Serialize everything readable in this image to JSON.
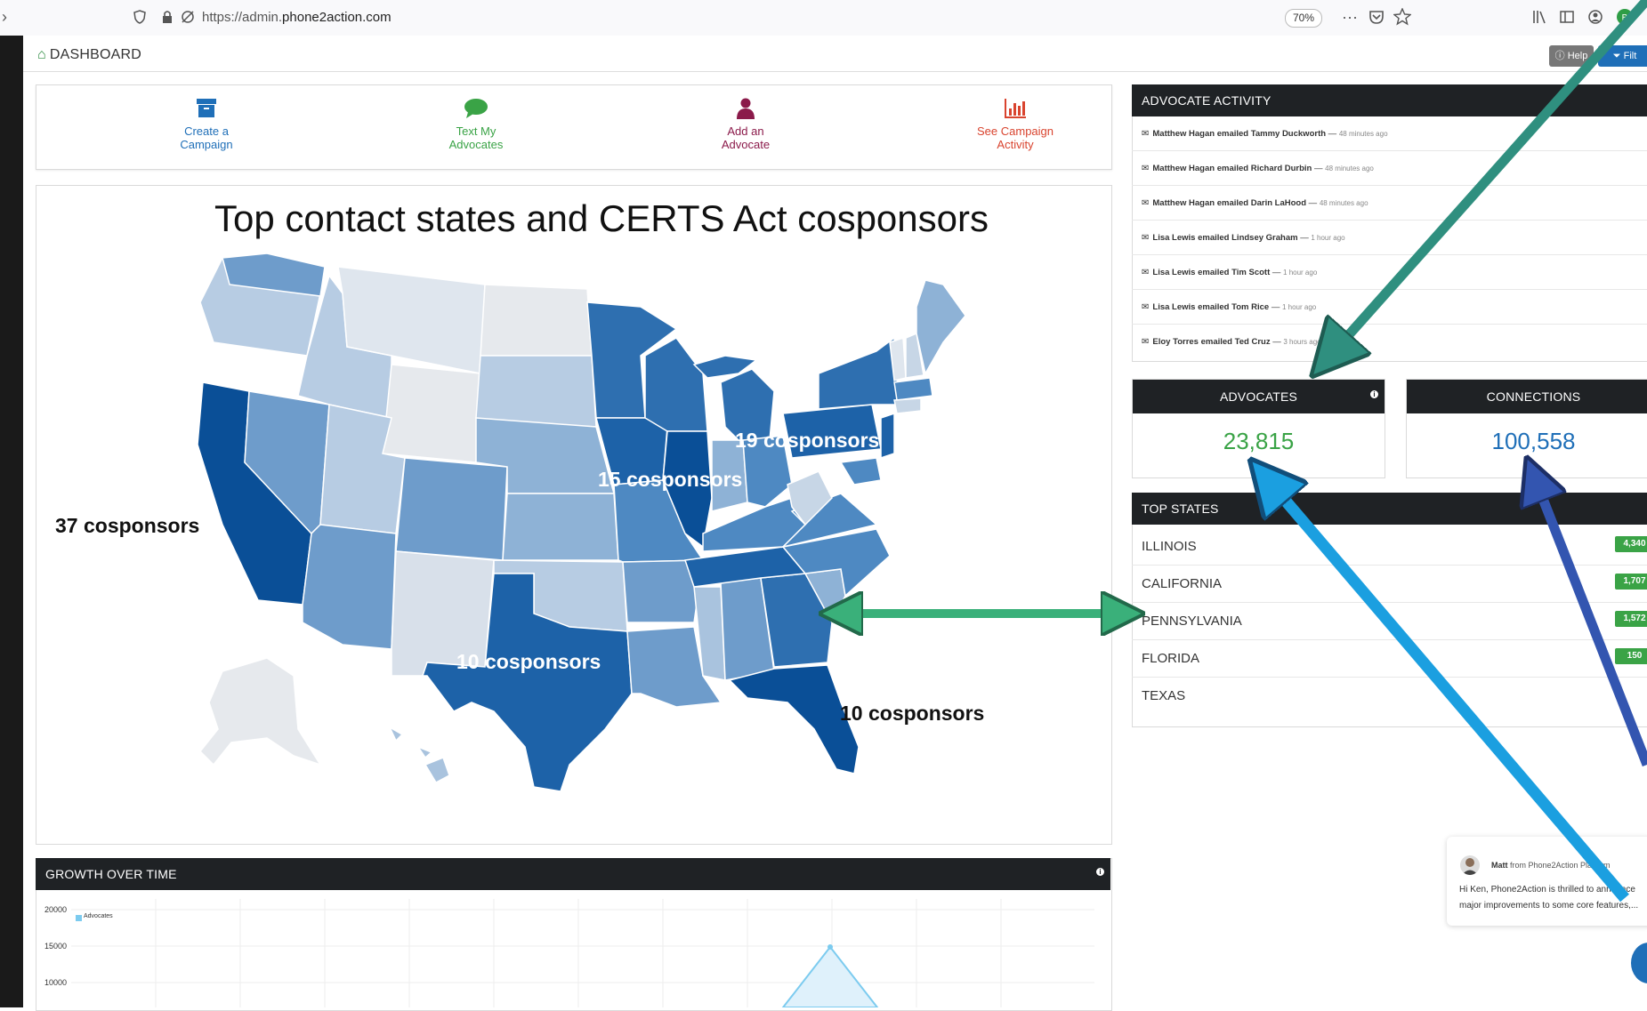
{
  "browser": {
    "url_prefix": "https://admin.",
    "url_domain": "phone2action.com",
    "zoom": "70%",
    "menu_glyph": "···"
  },
  "header": {
    "title": "DASHBOARD",
    "help_label": "Help",
    "filter_label": "Filt"
  },
  "quick_actions": [
    {
      "line1": "Create a",
      "line2": "Campaign",
      "color": "#1f6fb8"
    },
    {
      "line1": "Text My",
      "line2": "Advocates",
      "color": "#3aa346"
    },
    {
      "line1": "Add an",
      "line2": "Advocate",
      "color": "#8b1a4a"
    },
    {
      "line1": "See Campaign",
      "line2": "Activity",
      "color": "#d9442f"
    }
  ],
  "map": {
    "title": "Top contact states and CERTS Act cosponsors",
    "labels": {
      "ca": "37 cosponsors",
      "il": "15 cosponsors",
      "pa": "19 cosponsors",
      "tx": "10 cosponsors",
      "fl": "10 cosponsors"
    }
  },
  "activity": {
    "title": "ADVOCATE ACTIVITY",
    "items": [
      {
        "actor": "Matthew Hagan",
        "verb": "emailed",
        "target": "Tammy Duckworth",
        "ago": "48 minutes ago"
      },
      {
        "actor": "Matthew Hagan",
        "verb": "emailed",
        "target": "Richard Durbin",
        "ago": "48 minutes ago"
      },
      {
        "actor": "Matthew Hagan",
        "verb": "emailed",
        "target": "Darin LaHood",
        "ago": "48 minutes ago"
      },
      {
        "actor": "Lisa Lewis",
        "verb": "emailed",
        "target": "Lindsey Graham",
        "ago": "1 hour ago"
      },
      {
        "actor": "Lisa Lewis",
        "verb": "emailed",
        "target": "Tim Scott",
        "ago": "1 hour ago"
      },
      {
        "actor": "Lisa Lewis",
        "verb": "emailed",
        "target": "Tom Rice",
        "ago": "1 hour ago"
      },
      {
        "actor": "Eloy Torres",
        "verb": "emailed",
        "target": "Ted Cruz",
        "ago": "3 hours ago"
      }
    ]
  },
  "stats": {
    "advocates_label": "ADVOCATES",
    "advocates_value": "23,815",
    "connections_label": "CONNECTIONS",
    "connections_value": "100,558",
    "advocates_color": "#3aa346",
    "connections_color": "#1f6fb8"
  },
  "top_states": {
    "title": "TOP STATES",
    "items": [
      {
        "name": "ILLINOIS",
        "count": "4,340"
      },
      {
        "name": "CALIFORNIA",
        "count": "1,707"
      },
      {
        "name": "PENNSYLVANIA",
        "count": "1,572"
      },
      {
        "name": "FLORIDA",
        "count": "150"
      },
      {
        "name": "TEXAS",
        "count": ""
      }
    ]
  },
  "growth": {
    "title": "GROWTH OVER TIME",
    "legend": "Advocates",
    "yticks": [
      "20000",
      "15000",
      "10000"
    ]
  },
  "chat": {
    "sender": "Matt",
    "from_text": " from Phone2Action Platform",
    "line1": "Hi Ken, Phone2Action is thrilled to announce",
    "line2": "major improvements to some core features,..."
  },
  "colors": {
    "header_dark": "#1f2225",
    "map_darkest": "#0a4f97",
    "map_dark": "#1d62a8",
    "map_mid": "#4e89c2",
    "map_light": "#8eb2d6",
    "map_lightest": "#c7d6e6",
    "arrow_teal": "#2f8f7f",
    "arrow_blue": "#1b9fe0",
    "arrow_indigo": "#3355b0",
    "arrow_green": "#3ab07a"
  }
}
